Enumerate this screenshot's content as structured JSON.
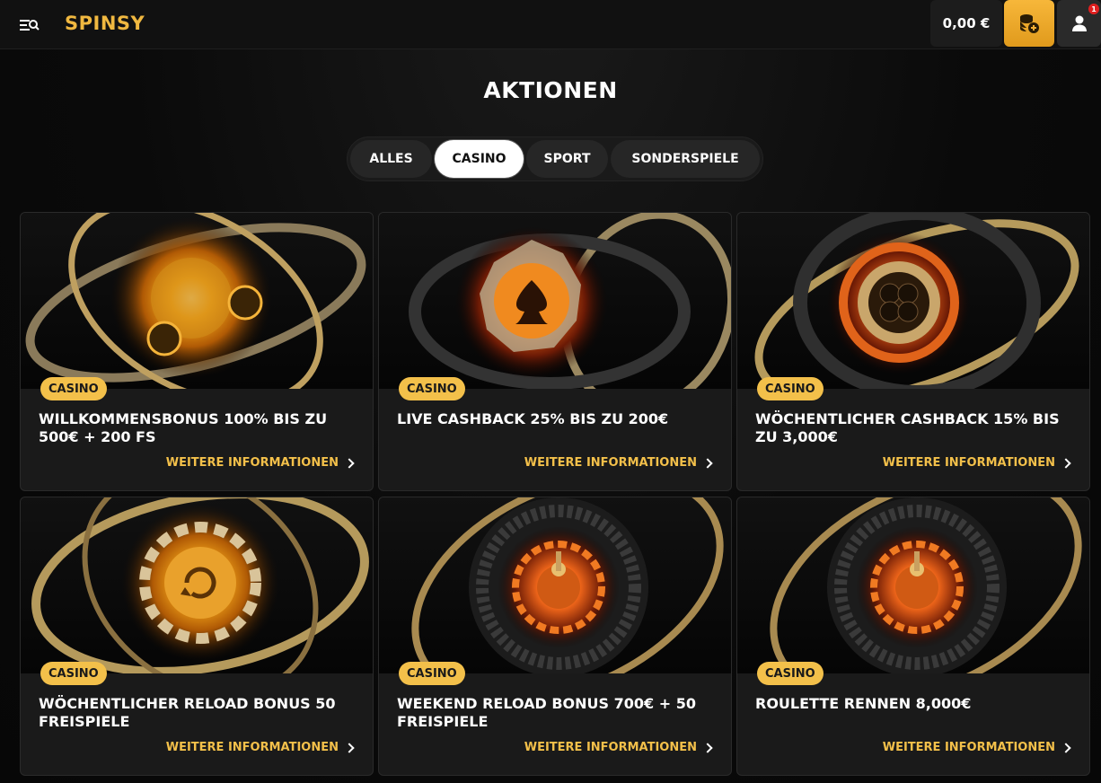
{
  "header": {
    "logo": "SPINSY",
    "balance": "0,00 €",
    "notification_count": "1"
  },
  "page_title": "AKTIONEN",
  "tabs": [
    {
      "label": "ALLES",
      "active": false
    },
    {
      "label": "CASINO",
      "active": true
    },
    {
      "label": "SPORT",
      "active": false
    },
    {
      "label": "SONDERSPIELE",
      "active": false
    }
  ],
  "cards": [
    {
      "tag": "CASINO",
      "title": "WILLKOMMENSBONUS 100% BIS ZU 500€ + 200 FS",
      "link": "WEITERE INFORMATIONEN",
      "icon": "heart-dice-icon"
    },
    {
      "tag": "CASINO",
      "title": "LIVE CASHBACK 25% BIS ZU 200€",
      "link": "WEITERE INFORMATIONEN",
      "icon": "spade-chip-icon"
    },
    {
      "tag": "CASINO",
      "title": "WÖCHENTLICHER CASHBACK 15% BIS ZU 3,000€",
      "link": "WEITERE INFORMATIONEN",
      "icon": "clover-chip-icon"
    },
    {
      "tag": "CASINO",
      "title": "WÖCHENTLICHER RELOAD BONUS 50 FREISPIELE",
      "link": "WEITERE INFORMATIONEN",
      "icon": "reload-chip-icon"
    },
    {
      "tag": "CASINO",
      "title": "WEEKEND RELOAD BONUS 700€ + 50 FREISPIELE",
      "link": "WEITERE INFORMATIONEN",
      "icon": "roulette-wheel-icon"
    },
    {
      "tag": "CASINO",
      "title": "ROULETTE RENNEN 8,000€",
      "link": "WEITERE INFORMATIONEN",
      "icon": "roulette-wheel-icon"
    }
  ],
  "colors": {
    "accent": "#f3c04a",
    "background": "#0b0b0b",
    "card": "#1a1a1a"
  }
}
